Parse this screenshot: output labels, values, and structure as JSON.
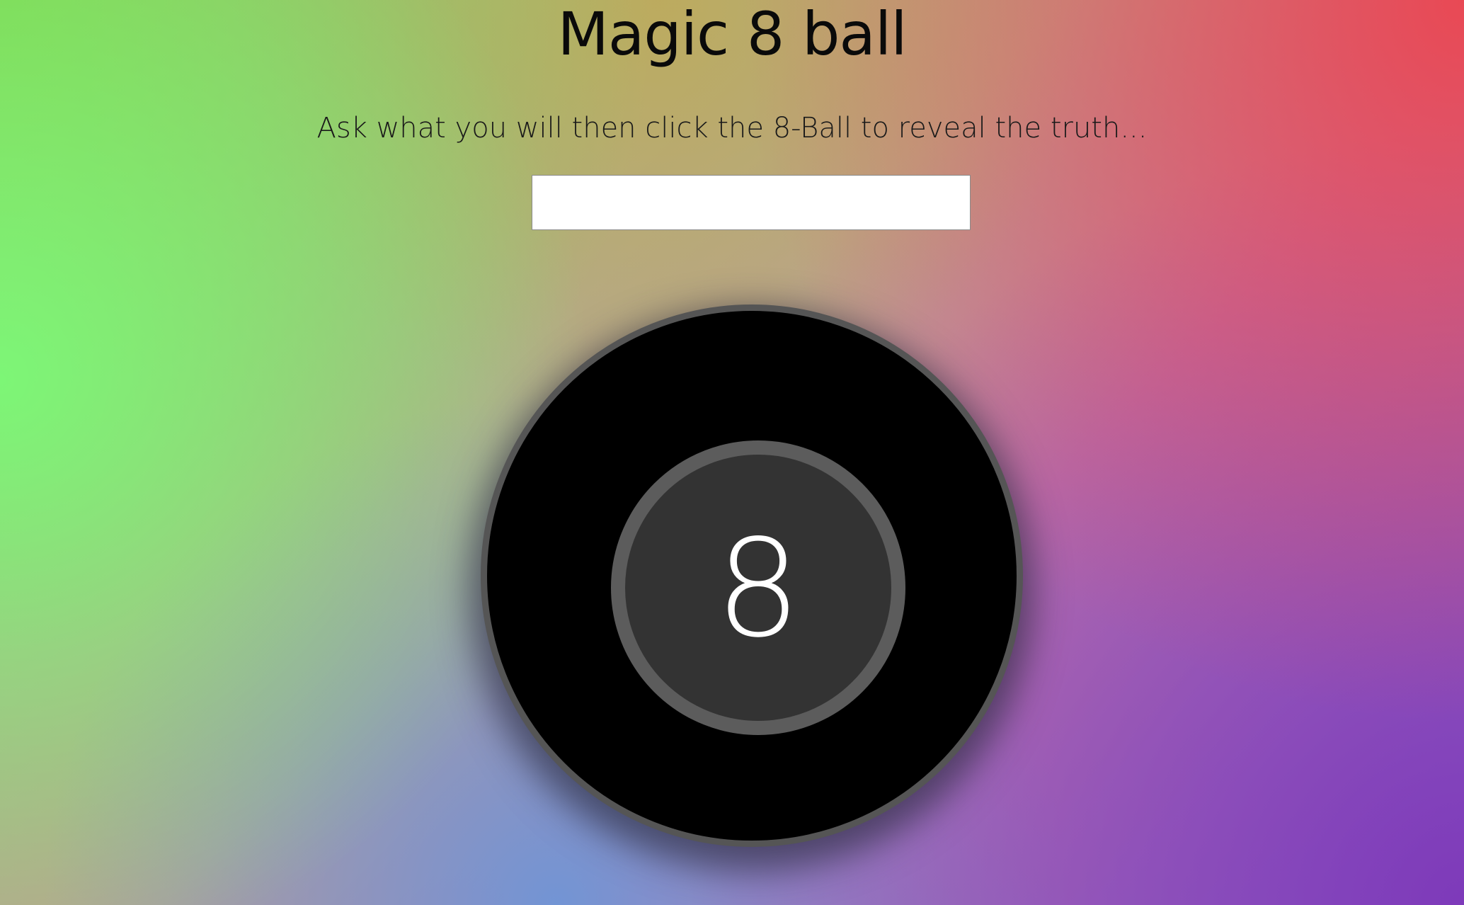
{
  "page": {
    "title": "Magic 8 ball",
    "subtitle": "Ask what you will then click the 8-Ball to reveal the truth..."
  },
  "question": {
    "value": "",
    "placeholder": ""
  },
  "ball": {
    "window_text": "8"
  },
  "colors": {
    "ball": "#000000",
    "ball_rim": "#555555",
    "window": "#333333",
    "window_rim": "#5c5c5c",
    "background_green": "#78ff78",
    "background_red": "#eb4650",
    "background_purple": "#7d37b9",
    "background_blue": "#6e96d7"
  }
}
